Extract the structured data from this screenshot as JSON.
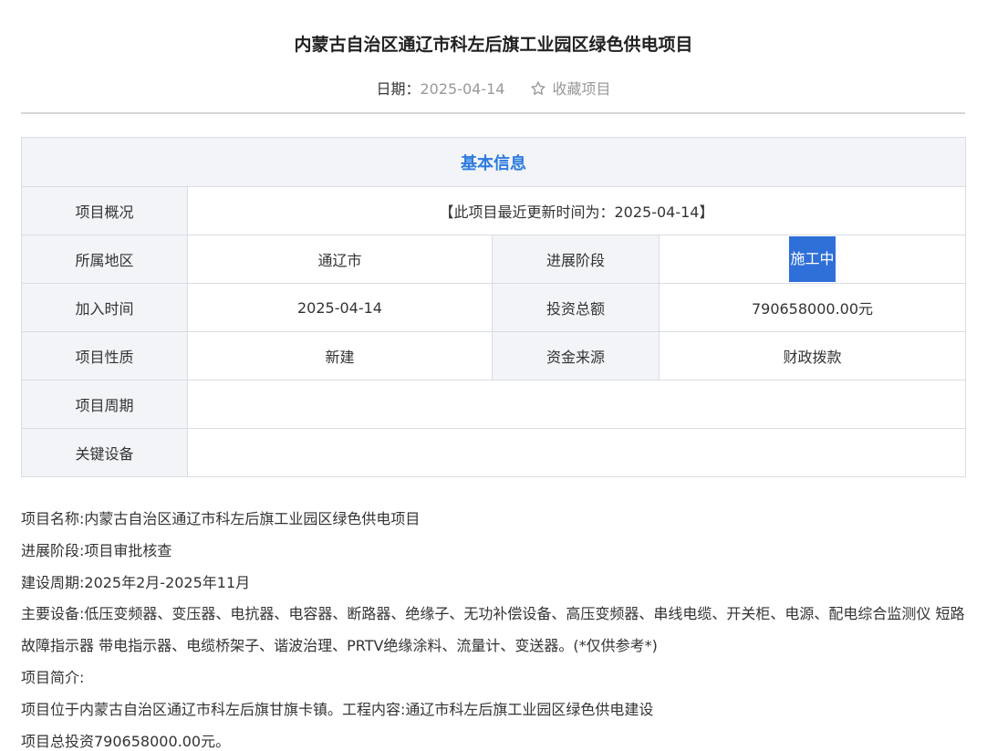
{
  "page": {
    "title": "内蒙古自治区通辽市科左后旗工业园区绿色供电项目",
    "date_label": "日期：",
    "date_value": "2025-04-14",
    "favorite_label": "收藏项目",
    "icon_favorite": "star-outline-icon"
  },
  "table": {
    "header": "基本信息",
    "overview_label": "项目概况",
    "overview_value": "【此项目最近更新时间为：2025-04-14】",
    "region_label": "所属地区",
    "region_value": "通辽市",
    "stage_label": "进展阶段",
    "stage_value": "施工中",
    "joined_label": "加入时间",
    "joined_value": "2025-04-14",
    "investment_label": "投资总额",
    "investment_value": "790658000.00元",
    "nature_label": "项目性质",
    "nature_value": "新建",
    "funding_label": "资金来源",
    "funding_value": "财政拨款",
    "cycle_label": "项目周期",
    "cycle_value": "",
    "equipment_label": "关键设备",
    "equipment_value": ""
  },
  "description": {
    "name": "项目名称:内蒙古自治区通辽市科左后旗工业园区绿色供电项目",
    "stage": "进展阶段:项目审批核查",
    "period": "建设周期:2025年2月-2025年11月",
    "equipment": "主要设备:低压变频器、变压器、电抗器、电容器、断路器、绝缘子、无功补偿设备、高压变频器、串线电缆、开关柜、电源、配电综合监测仪 短路故障指示器 带电指示器、电缆桥架子、谐波治理、PRTV绝缘涂料、流量计、变送器。(*仅供参考*)",
    "intro_label": "项目简介:",
    "location": "项目位于内蒙古自治区通辽市科左后旗甘旗卡镇。工程内容:通辽市科左后旗工业园区绿色供电建设",
    "total": "项目总投资790658000.00元。"
  },
  "colors": {
    "accent": "#2d7be0",
    "highlight": "#2f6fd8",
    "label_bg": "#f2f4f7"
  }
}
